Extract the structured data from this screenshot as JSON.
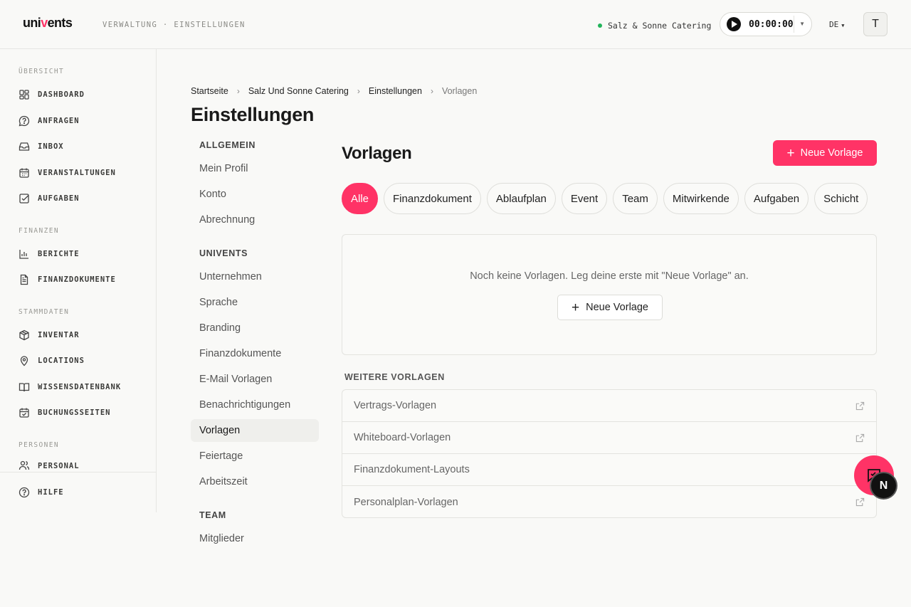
{
  "header": {
    "logo_prefix": "uni",
    "logo_accent": "v",
    "logo_suffix": "ents",
    "context": "VERWALTUNG · EINSTELLUNGEN",
    "company": "Salz & Sonne Catering",
    "timer": "00:00:00",
    "language": "DE",
    "user_initial": "T"
  },
  "sidebar": {
    "sections": {
      "overview": "ÜBERSICHT",
      "finance": "FINANZEN",
      "master": "STAMMDATEN",
      "people": "PERSONEN"
    },
    "items": {
      "dashboard": "DASHBOARD",
      "requests": "ANFRAGEN",
      "inbox": "INBOX",
      "events": "VERANSTALTUNGEN",
      "tasks": "AUFGABEN",
      "reports": "BERICHTE",
      "finance_docs": "FINANZDOKUMENTE",
      "inventory": "INVENTAR",
      "locations": "LOCATIONS",
      "knowledge": "WISSENSDATENBANK",
      "booking": "BUCHUNGSSEITEN",
      "staff": "PERSONAL"
    },
    "help": "HILFE"
  },
  "breadcrumb": [
    "Startseite",
    "Salz Und Sonne Catering",
    "Einstellungen",
    "Vorlagen"
  ],
  "page_title": "Einstellungen",
  "settings_nav": {
    "general": "ALLGEMEIN",
    "profile": "Mein Profil",
    "account": "Konto",
    "billing": "Abrechnung",
    "univents": "UNIVENTS",
    "company": "Unternehmen",
    "language": "Sprache",
    "branding": "Branding",
    "finance_docs": "Finanzdokumente",
    "email_templates": "E-Mail Vorlagen",
    "notifications": "Benachrichtigungen",
    "templates": "Vorlagen",
    "holidays": "Feiertage",
    "working_time": "Arbeitszeit",
    "team": "TEAM",
    "members": "Mitglieder"
  },
  "content": {
    "title": "Vorlagen",
    "new_button": "Neue Vorlage",
    "filters": [
      "Alle",
      "Finanzdokument",
      "Ablaufplan",
      "Event",
      "Team",
      "Mitwirkende",
      "Aufgaben",
      "Schicht"
    ],
    "empty_text": "Noch keine Vorlagen. Leg deine erste mit \"Neue Vorlage\" an.",
    "empty_button": "Neue Vorlage",
    "more_title": "WEITERE VORLAGEN",
    "more_items": [
      "Vertrags-Vorlagen",
      "Whiteboard-Vorlagen",
      "Finanzdokument-Layouts",
      "Personalplan-Vorlagen"
    ]
  },
  "badge_letter": "N",
  "colors": {
    "accent": "#ff3366",
    "status_online": "#22b45a"
  }
}
